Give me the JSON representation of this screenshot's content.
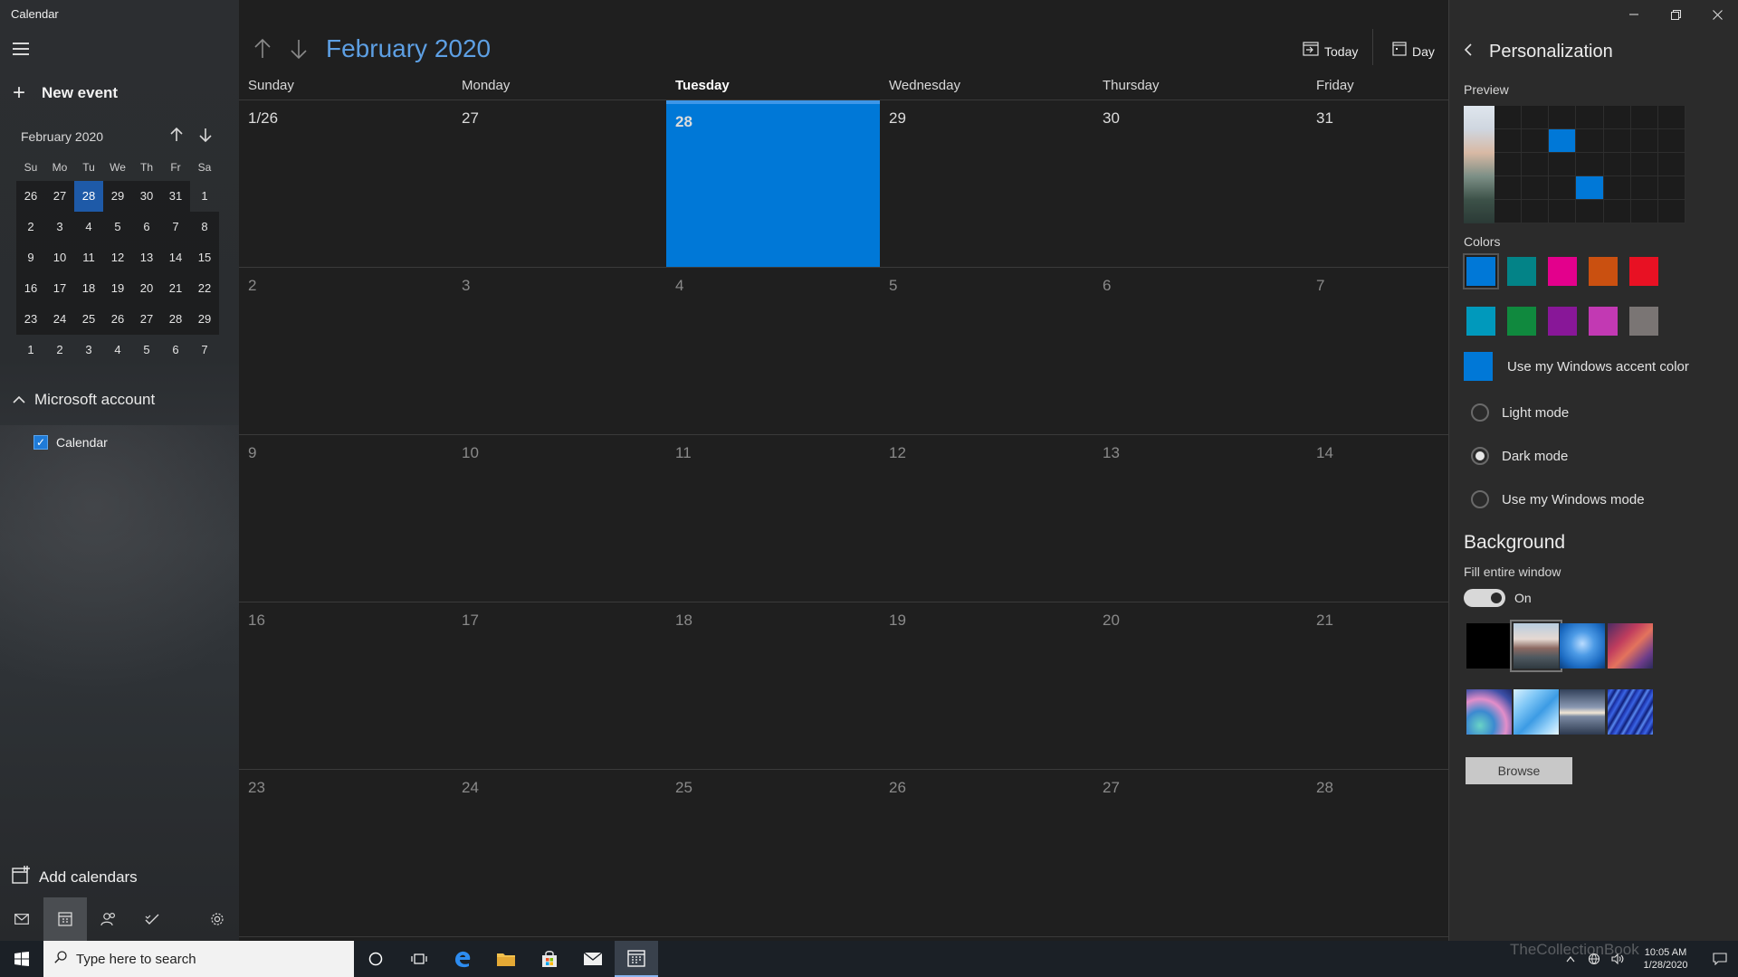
{
  "app": {
    "title": "Calendar"
  },
  "sidebar": {
    "new_event_label": "New event",
    "mini_calendar": {
      "month_label": "February 2020",
      "weekdays": [
        "Su",
        "Mo",
        "Tu",
        "We",
        "Th",
        "Fr",
        "Sa"
      ],
      "weeks": [
        [
          "26",
          "27",
          "28",
          "29",
          "30",
          "31",
          "1"
        ],
        [
          "2",
          "3",
          "4",
          "5",
          "6",
          "7",
          "8"
        ],
        [
          "9",
          "10",
          "11",
          "12",
          "13",
          "14",
          "15"
        ],
        [
          "16",
          "17",
          "18",
          "19",
          "20",
          "21",
          "22"
        ],
        [
          "23",
          "24",
          "25",
          "26",
          "27",
          "28",
          "29"
        ],
        [
          "1",
          "2",
          "3",
          "4",
          "5",
          "6",
          "7"
        ]
      ],
      "selected": "28"
    },
    "account_label": "Microsoft account",
    "calendar_item_label": "Calendar",
    "add_calendars_label": "Add calendars"
  },
  "main": {
    "month_title": "February 2020",
    "today_label": "Today",
    "day_label": "Day",
    "weekday_headers": [
      "Sunday",
      "Monday",
      "Tuesday",
      "Wednesday",
      "Thursday",
      "Friday"
    ],
    "weeks": [
      [
        "1/26",
        "27",
        "28",
        "29",
        "30",
        "31"
      ],
      [
        "2",
        "3",
        "4",
        "5",
        "6",
        "7"
      ],
      [
        "9",
        "10",
        "11",
        "12",
        "13",
        "14"
      ],
      [
        "16",
        "17",
        "18",
        "19",
        "20",
        "21"
      ],
      [
        "23",
        "24",
        "25",
        "26",
        "27",
        "28"
      ]
    ],
    "today_cell": "28"
  },
  "panel": {
    "title": "Personalization",
    "preview_label": "Preview",
    "colors_label": "Colors",
    "colors": [
      "#0078d7",
      "#038387",
      "#e3008c",
      "#ca5010",
      "#e81123",
      "#0099bc",
      "#10893e",
      "#881798",
      "#c239b3",
      "#7a7574"
    ],
    "accent_label": "Use my Windows accent color",
    "modes": [
      "Light mode",
      "Dark mode",
      "Use my Windows mode"
    ],
    "selected_mode": "Dark mode",
    "background_title": "Background",
    "fill_label": "Fill entire window",
    "toggle_state": "On",
    "browse_label": "Browse"
  },
  "taskbar": {
    "search_placeholder": "Type here to search",
    "time": "10:05 AM",
    "date": "1/28/2020",
    "watermark": "TheCollectionBook"
  },
  "colors": {
    "accent": "#0078d7",
    "background": "#1f1f1f",
    "panel": "#2b2b2b"
  }
}
